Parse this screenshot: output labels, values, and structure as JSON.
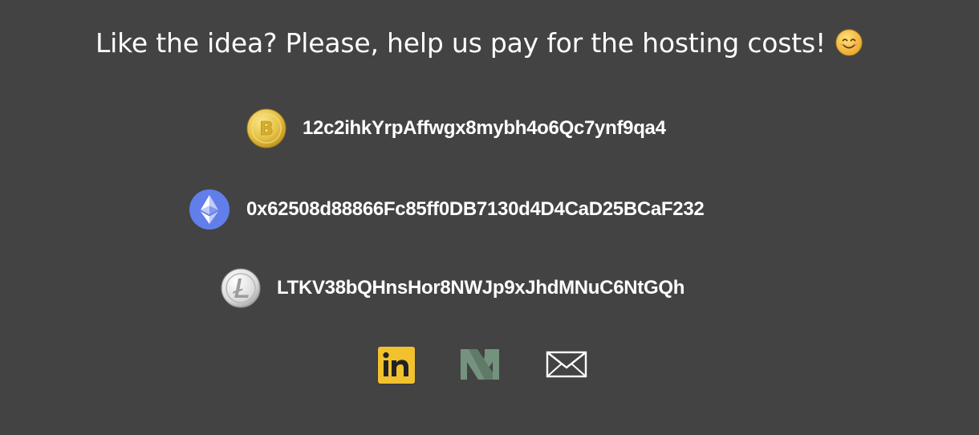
{
  "headline": {
    "text": "Like the idea? Please, help us pay for the hosting costs!",
    "emoji_icon": "smiling-face-icon"
  },
  "wallets": [
    {
      "coin": "bitcoin",
      "icon": "bitcoin-icon",
      "address": "12c2ihkYrpAffwgx8mybh4o6Qc7ynf9qa4",
      "color": "#E8C64A"
    },
    {
      "coin": "ethereum",
      "icon": "ethereum-icon",
      "address": "0x62508d88866Fc85ff0DB7130d4D4CaD25BCaF232",
      "color": "#627EEA"
    },
    {
      "coin": "litecoin",
      "icon": "litecoin-icon",
      "address": "LTKV38bQHnsHor8NWJp9xJhdMNuC6NtGQh",
      "color": "#BDBDBD"
    }
  ],
  "social": [
    {
      "name": "linkedin",
      "icon": "linkedin-icon",
      "color": "#F2C12E"
    },
    {
      "name": "medium",
      "icon": "medium-icon",
      "color": "#74927D"
    },
    {
      "name": "email",
      "icon": "mail-icon",
      "color": "#FFFFFF"
    }
  ]
}
